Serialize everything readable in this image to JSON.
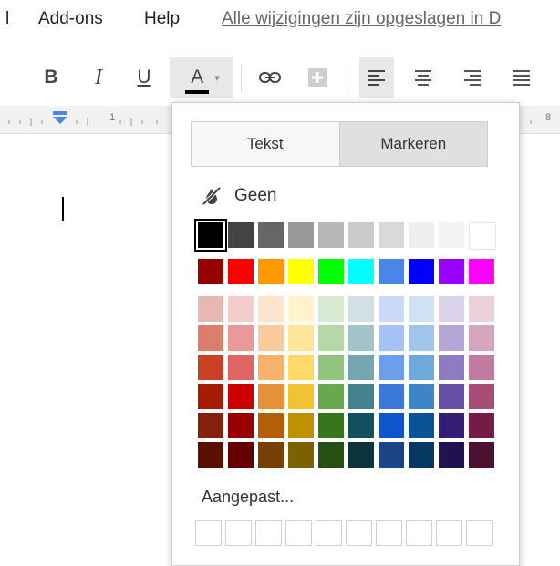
{
  "menubar": {
    "items": [
      {
        "label": "l"
      },
      {
        "label": "Add-ons"
      },
      {
        "label": "Help"
      }
    ],
    "save_status": "Alle wijzigingen zijn opgeslagen in D"
  },
  "toolbar": {
    "bold": "B",
    "italic": "I",
    "underline": "U",
    "text_color": "A",
    "text_color_chevron": "▾",
    "icons": [
      "link-icon",
      "insert-comment-icon",
      "align-left-icon",
      "align-center-icon",
      "align-right-icon",
      "align-justify-icon"
    ]
  },
  "ruler": {
    "marks": [
      "1",
      "8"
    ]
  },
  "color_menu": {
    "tabs": {
      "text": "Tekst",
      "highlight": "Markeren"
    },
    "none_label": "Geen",
    "custom_label": "Aangepast...",
    "grayscale": [
      "#000000",
      "#434343",
      "#666666",
      "#999999",
      "#b7b7b7",
      "#cccccc",
      "#d9d9d9",
      "#efefef",
      "#f3f3f3",
      "#ffffff"
    ],
    "bright": [
      "#980000",
      "#ff0000",
      "#ff9900",
      "#ffff00",
      "#00ff00",
      "#00ffff",
      "#4a86e8",
      "#0000ff",
      "#9900ff",
      "#ff00ff"
    ],
    "shades": [
      [
        "#e6b8af",
        "#f4cccc",
        "#fce5cd",
        "#fff2cc",
        "#d9ead3",
        "#d0e0e3",
        "#c9daf8",
        "#cfe2f3",
        "#d9d2e9",
        "#ead1dc"
      ],
      [
        "#dd7e6b",
        "#ea9999",
        "#f9cb9c",
        "#ffe599",
        "#b6d7a8",
        "#a2c4c9",
        "#a4c2f4",
        "#9fc5e8",
        "#b4a7d6",
        "#d5a6bd"
      ],
      [
        "#cc4125",
        "#e06666",
        "#f6b26b",
        "#ffd966",
        "#93c47d",
        "#76a5af",
        "#6d9eeb",
        "#6fa8dc",
        "#8e7cc3",
        "#c27ba0"
      ],
      [
        "#a61c00",
        "#cc0000",
        "#e69138",
        "#f1c232",
        "#6aa84f",
        "#45818e",
        "#3c78d8",
        "#3d85c6",
        "#674ea7",
        "#a64d79"
      ],
      [
        "#85200c",
        "#990000",
        "#b45f06",
        "#bf9000",
        "#38761d",
        "#134f5c",
        "#1155cc",
        "#0b5394",
        "#351c75",
        "#741b47"
      ],
      [
        "#5b0f00",
        "#660000",
        "#783f04",
        "#7f6000",
        "#274e13",
        "#0c343d",
        "#1c4587",
        "#073763",
        "#20124d",
        "#4c1130"
      ]
    ],
    "selected_color": "#000000"
  }
}
